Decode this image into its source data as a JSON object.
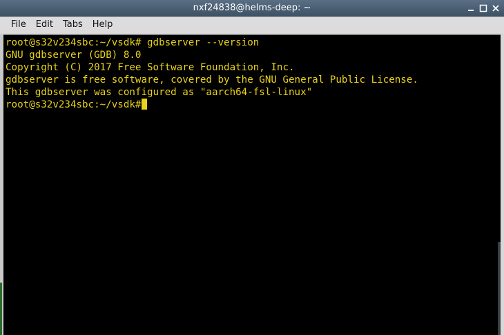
{
  "window": {
    "title": "nxf24838@helms-deep: ~",
    "controls": [
      {
        "icon": "minimize-icon"
      },
      {
        "icon": "maximize-icon"
      },
      {
        "icon": "close-icon"
      }
    ]
  },
  "menubar": {
    "items": [
      {
        "label": "File"
      },
      {
        "label": "Edit"
      },
      {
        "label": "Tabs"
      },
      {
        "label": "Help"
      }
    ]
  },
  "terminal": {
    "text_color": "#e8d21b",
    "background": "#000000",
    "lines": [
      "root@s32v234sbc:~/vsdk# gdbserver --version",
      "GNU gdbserver (GDB) 8.0",
      "Copyright (C) 2017 Free Software Foundation, Inc.",
      "gdbserver is free software, covered by the GNU General Public License.",
      "This gdbserver was configured as \"aarch64-fsl-linux\"",
      "root@s32v234sbc:~/vsdk#"
    ]
  }
}
